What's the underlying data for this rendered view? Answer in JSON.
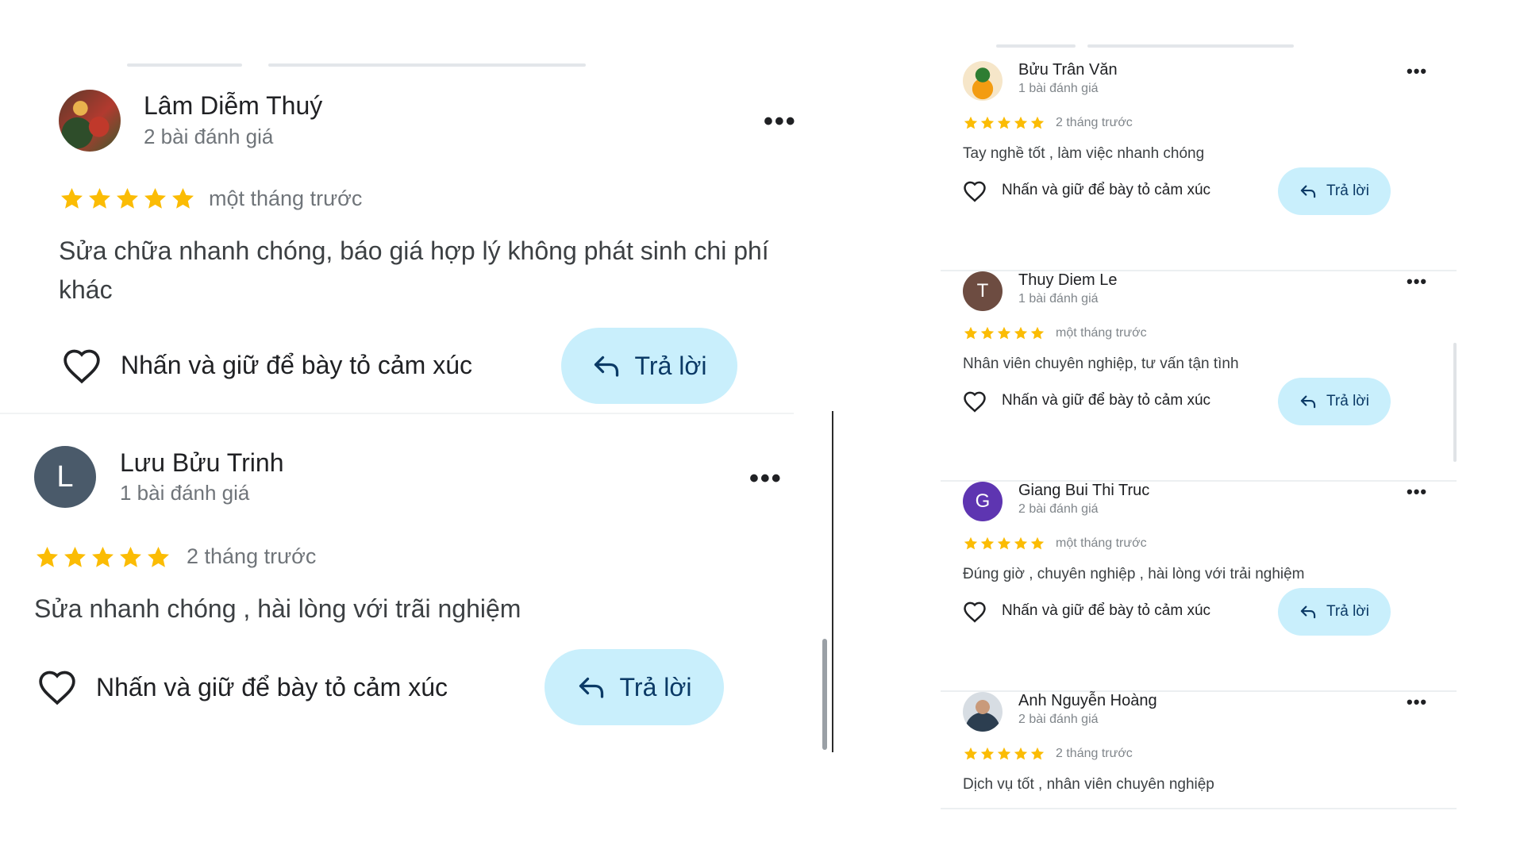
{
  "colors": {
    "star": "#fbbc04",
    "reply_bg": "#c9effc",
    "avatar_l": "#4a5a6a",
    "avatar_t": "#6d4c41",
    "avatar_g": "#5e35b1"
  },
  "left_reviews": [
    {
      "name": "Lâm Diễm Thuý",
      "count": "2 bài đánh giá",
      "rating": 5,
      "date": "một tháng trước",
      "text": "Sửa chữa nhanh chóng, báo giá hợp lý không phát sinh chi phí khác",
      "react": "Nhấn và giữ để bày tỏ cảm xúc",
      "reply": "Trả lời",
      "more": "•••"
    },
    {
      "name": "Lưu Bửu Trinh",
      "initial": "L",
      "count": "1 bài đánh giá",
      "rating": 5,
      "date": "2 tháng trước",
      "text": "Sửa nhanh chóng , hài lòng với trãi nghiệm",
      "react": "Nhấn và giữ để bày tỏ cảm xúc",
      "reply": "Trả lời",
      "more": "•••"
    }
  ],
  "right_reviews": [
    {
      "name": "Bửu Trân Văn",
      "count": "1 bài đánh giá",
      "rating": 5,
      "date": "2 tháng trước",
      "text": "Tay nghề tốt , làm việc nhanh chóng",
      "react": "Nhấn và giữ để bày tỏ cảm xúc",
      "reply": "Trả lời",
      "more": "•••"
    },
    {
      "name": "Thuy Diem Le",
      "initial": "T",
      "count": "1 bài đánh giá",
      "rating": 5,
      "date": "một tháng trước",
      "text": "Nhân viên chuyên nghiệp, tư vấn tận tình",
      "react": "Nhấn và giữ để bày tỏ cảm xúc",
      "reply": "Trả lời",
      "more": "•••"
    },
    {
      "name": "Giang Bui Thi Truc",
      "initial": "G",
      "count": "2 bài đánh giá",
      "rating": 5,
      "date": "một tháng trước",
      "text": "Đúng giờ , chuyên nghiệp , hài lòng với trải nghiệm",
      "react": "Nhấn và giữ để bày tỏ cảm xúc",
      "reply": "Trả lời",
      "more": "•••"
    },
    {
      "name": "Anh Nguyễn Hoàng",
      "count": "2 bài đánh giá",
      "rating": 5,
      "date": "2 tháng trước",
      "text": "Dịch vụ tốt , nhân viên chuyên nghiệp",
      "more": "•••"
    }
  ]
}
